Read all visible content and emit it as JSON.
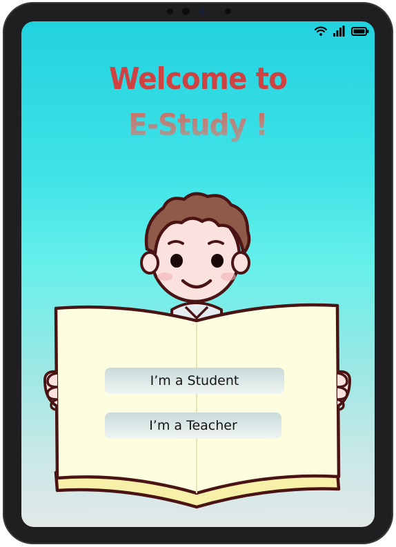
{
  "welcome": {
    "line1": "Welcome to",
    "line2": "E-Study !"
  },
  "roles": {
    "student_label": "I’m a Student",
    "teacher_label": "I’m a Teacher"
  },
  "status_bar": {
    "icons": [
      "wifi-icon",
      "cellular-signal-icon",
      "battery-icon"
    ]
  },
  "colors": {
    "title_red": "#d04141",
    "title_gray": "#9aa4a0",
    "sky_top": "#22d2df",
    "sky_bottom": "#e3e8e8",
    "book_page": "#fdfde0",
    "button_top": "#c8dada"
  },
  "illustration": "boy-holding-open-book"
}
